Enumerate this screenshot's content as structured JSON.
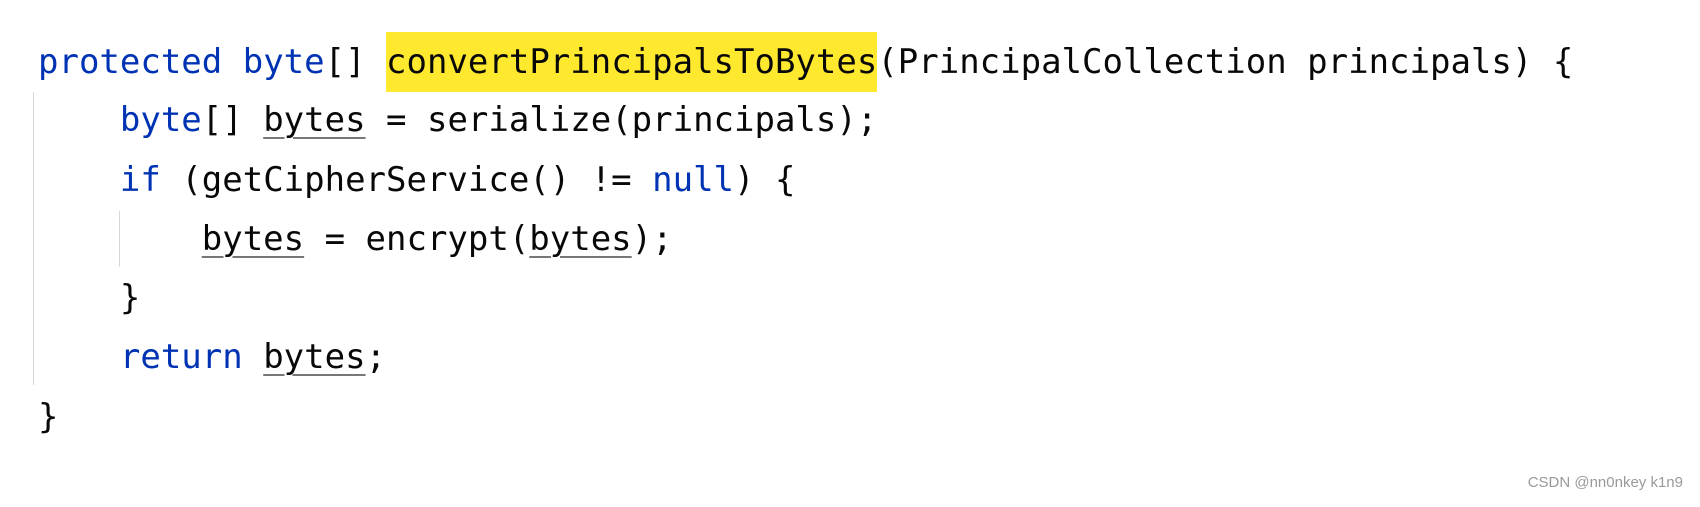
{
  "editor": {
    "lines": [
      [
        {
          "t": "protected",
          "k": "kw"
        },
        {
          "t": " "
        },
        {
          "t": "byte",
          "k": "kw"
        },
        {
          "t": "[] "
        },
        {
          "t": "convertPrincipalsToBytes",
          "k": "hl"
        },
        {
          "t": "(PrincipalCollection principals) {"
        }
      ],
      [
        {
          "t": "    "
        },
        {
          "t": "byte",
          "k": "kw"
        },
        {
          "t": "[] "
        },
        {
          "t": "bytes",
          "k": "var"
        },
        {
          "t": " = serialize(principals);"
        }
      ],
      [
        {
          "t": "    "
        },
        {
          "t": "if",
          "k": "kw"
        },
        {
          "t": " (getCipherService() != "
        },
        {
          "t": "null",
          "k": "kw"
        },
        {
          "t": ") {"
        }
      ],
      [
        {
          "t": "        "
        },
        {
          "t": "bytes",
          "k": "var"
        },
        {
          "t": " = encrypt("
        },
        {
          "t": "bytes",
          "k": "var"
        },
        {
          "t": ");"
        }
      ],
      [
        {
          "t": "    }"
        }
      ],
      [
        {
          "t": "    "
        },
        {
          "t": "return",
          "k": "kw"
        },
        {
          "t": " "
        },
        {
          "t": "bytes",
          "k": "var"
        },
        {
          "t": ";"
        }
      ],
      [
        {
          "t": "}"
        }
      ]
    ],
    "colors": {
      "keyword": "#0033b3",
      "text": "#080808",
      "highlight": "#ffe92e"
    }
  },
  "watermark": "CSDN @nn0nkey k1n9"
}
